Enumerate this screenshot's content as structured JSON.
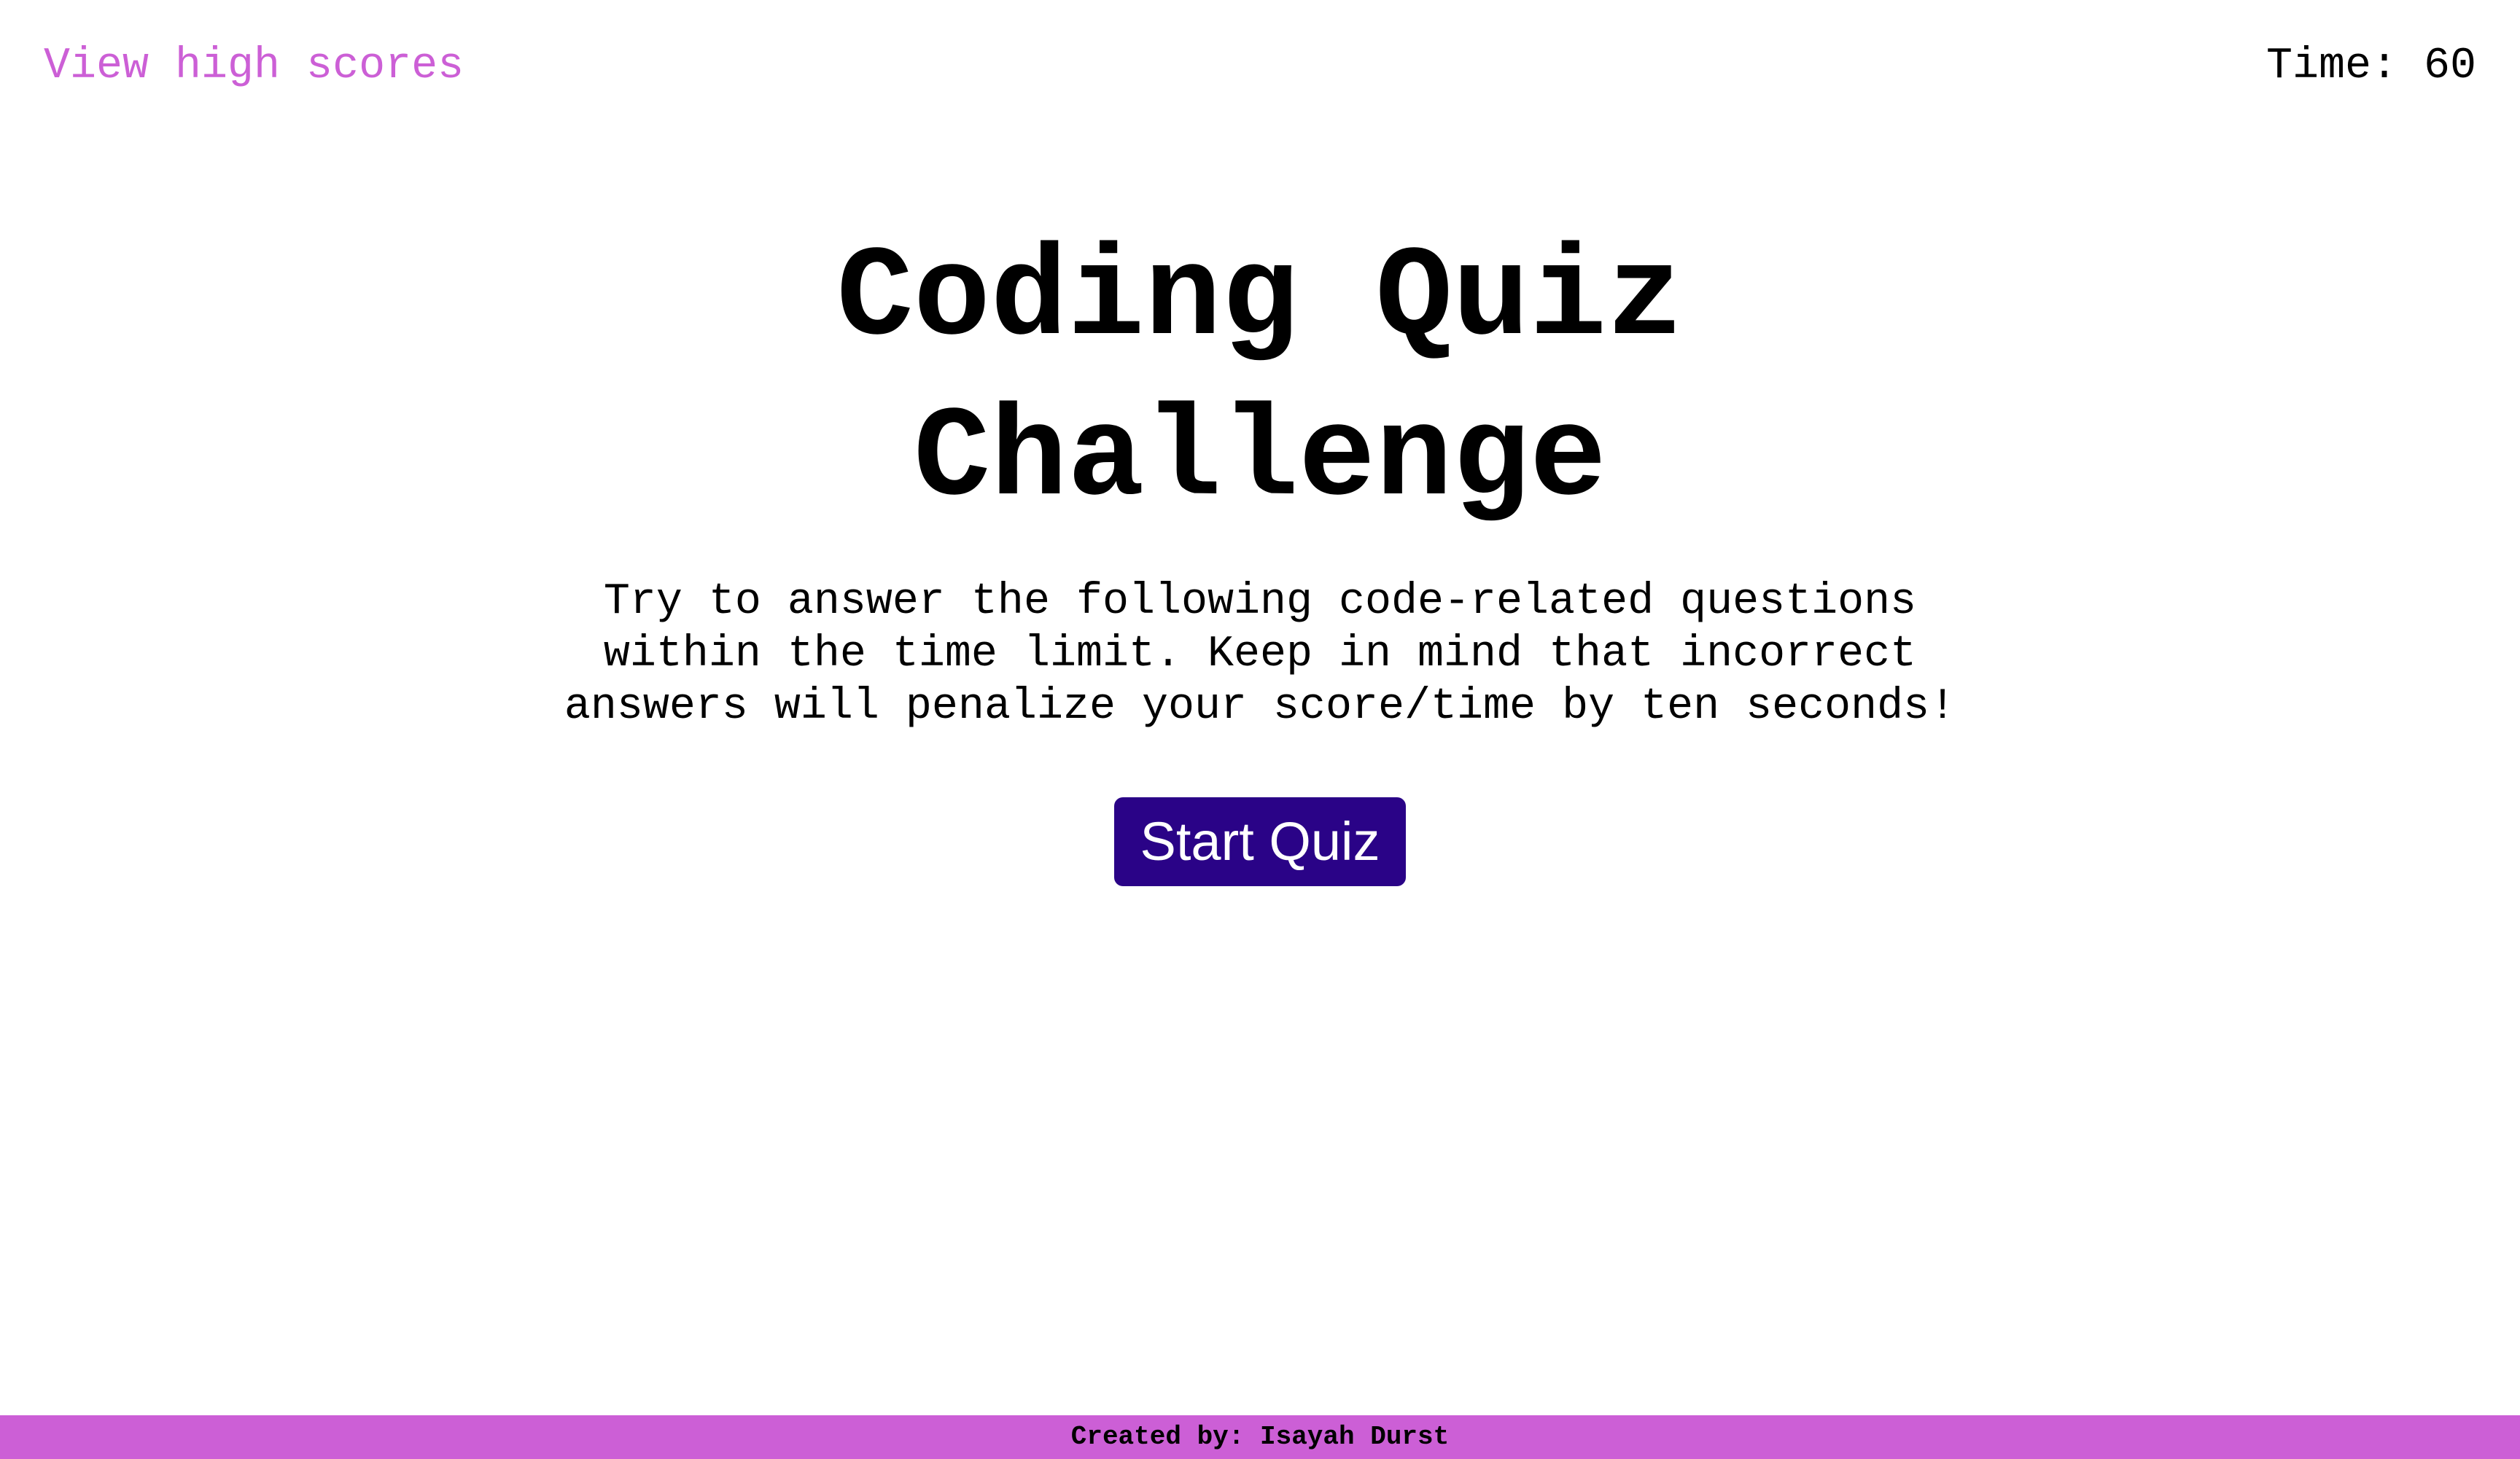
{
  "header": {
    "high_scores_label": "View high scores",
    "timer_label": "Time:",
    "timer_value": "60"
  },
  "main": {
    "title": "Coding Quiz Challenge",
    "description": "Try to answer the following code-related questions within the time limit. Keep in mind that incorrect answers will penalize your score/time by ten seconds!",
    "start_button_label": "Start Quiz"
  },
  "footer": {
    "credit_text": "Created by: Isayah Durst"
  },
  "colors": {
    "accent": "#cc5fd6",
    "button": "#2a0387",
    "background": "#ffffff",
    "text": "#000000"
  }
}
